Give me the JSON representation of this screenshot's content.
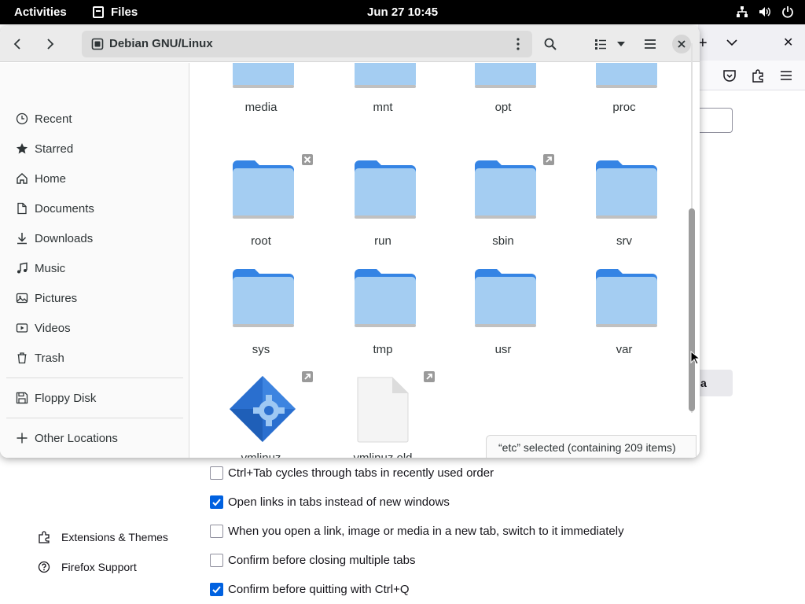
{
  "topbar": {
    "activities": "Activities",
    "app_name": "Files",
    "clock": "Jun 27  10:45",
    "icons": [
      "network-icon",
      "volume-icon",
      "power-icon"
    ]
  },
  "window": {
    "path_label": "Debian GNU/Linux",
    "status": "“etc” selected  (containing 209 items)"
  },
  "sidebar": {
    "items": [
      {
        "label": "Recent",
        "icon": "clock-icon"
      },
      {
        "label": "Starred",
        "icon": "star-icon"
      },
      {
        "label": "Home",
        "icon": "home-icon"
      },
      {
        "label": "Documents",
        "icon": "document-icon"
      },
      {
        "label": "Downloads",
        "icon": "download-icon"
      },
      {
        "label": "Music",
        "icon": "music-icon"
      },
      {
        "label": "Pictures",
        "icon": "picture-icon"
      },
      {
        "label": "Videos",
        "icon": "video-icon"
      },
      {
        "label": "Trash",
        "icon": "trash-icon"
      }
    ],
    "devices": [
      {
        "label": "Floppy Disk",
        "icon": "floppy-icon"
      }
    ],
    "other": {
      "label": "Other Locations",
      "icon": "plus-icon"
    }
  },
  "files": {
    "row0": [
      "media",
      "mnt",
      "opt",
      "proc"
    ],
    "row1": [
      "root",
      "run",
      "sbin",
      "srv"
    ],
    "row2": [
      "sys",
      "tmp",
      "usr",
      "var"
    ],
    "row3": [
      "vmlinuz",
      "vmlinuz.old"
    ]
  },
  "firefox": {
    "tab_new": "+",
    "btn_fragment": "a",
    "side": [
      {
        "label": "Extensions & Themes",
        "icon": "puzzle-icon"
      },
      {
        "label": "Firefox Support",
        "icon": "help-icon"
      }
    ],
    "options": [
      {
        "label": "Ctrl+Tab cycles through tabs in recently used order",
        "checked": false
      },
      {
        "label": "Open links in tabs instead of new windows",
        "checked": true
      },
      {
        "label": "When you open a link, image or media in a new tab, switch to it immediately",
        "checked": false
      },
      {
        "label": "Confirm before closing multiple tabs",
        "checked": false
      },
      {
        "label": "Confirm before quitting with Ctrl+Q",
        "checked": true
      }
    ]
  },
  "colors": {
    "folder_back": "#3584e4",
    "folder_front": "#a4cdf2",
    "checkbox_on": "#0061e0"
  }
}
